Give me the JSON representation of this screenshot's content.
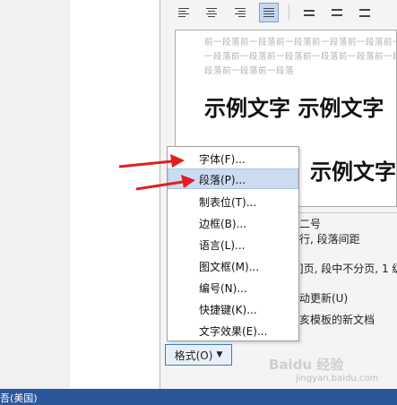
{
  "status_bar": {
    "language": "吾(美国)"
  },
  "watermark": {
    "brand": "Baidu 经验",
    "url": "jingyan.baidu.com"
  },
  "toolbar": {
    "buttons": [
      {
        "name": "align-left",
        "active": false
      },
      {
        "name": "align-center",
        "active": false
      },
      {
        "name": "align-right",
        "active": false
      },
      {
        "name": "align-justify",
        "active": true
      },
      {
        "name": "line-spacing-single",
        "active": false
      },
      {
        "name": "line-spacing-1-5",
        "active": false
      },
      {
        "name": "line-spacing-double",
        "active": false
      }
    ]
  },
  "preview": {
    "prev_line_1": "前一段落前一段落前一段落前一段落前一段落前一段落",
    "prev_line_2": "一段落前一段落前一段落前一段落前一段落前一段落前",
    "prev_line_3": "段落前一段落前一段落",
    "sample_1": "示例文字 示例文字",
    "sample_2": "示例文字"
  },
  "description": {
    "line1": "二号",
    "line2": "行, 段落间距",
    "line3": "]页, 段中不分页, 1 级",
    "auto_update": "动更新(U)",
    "template": "亥模板的新文档"
  },
  "menu": {
    "items": [
      {
        "label": "字体(F)...",
        "highlighted": false
      },
      {
        "label": "段落(P)...",
        "highlighted": true
      },
      {
        "label": "制表位(T)...",
        "highlighted": false
      },
      {
        "label": "边框(B)...",
        "highlighted": false
      },
      {
        "label": "语言(L)...",
        "highlighted": false
      },
      {
        "label": "图文框(M)...",
        "highlighted": false
      },
      {
        "label": "编号(N)...",
        "highlighted": false
      },
      {
        "label": "快捷键(K)...",
        "highlighted": false
      },
      {
        "label": "文字效果(E)...",
        "highlighted": false
      }
    ]
  },
  "format_button": {
    "label": "格式(O)",
    "arrow": "▼"
  },
  "colors": {
    "highlight": "#cbdcf1",
    "status_bar": "#2b579a",
    "arrow": "#e02020"
  }
}
